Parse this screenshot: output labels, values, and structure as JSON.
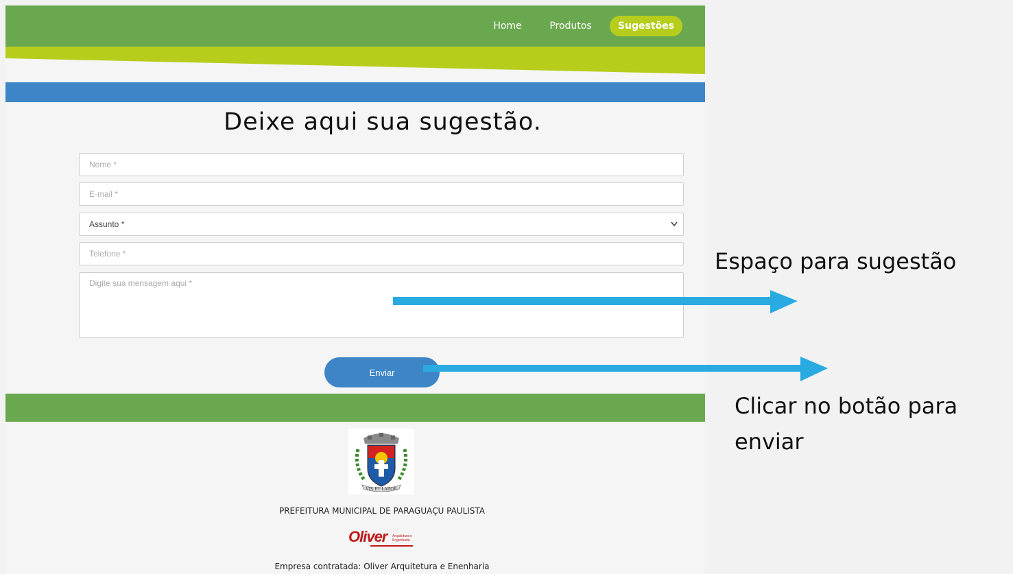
{
  "nav": {
    "items": [
      {
        "label": "Home"
      },
      {
        "label": "Produtos"
      },
      {
        "label": "Sugestões",
        "active": true
      }
    ]
  },
  "main": {
    "title": "Deixe aqui sua sugestão.",
    "form": {
      "nome_placeholder": "Nome *",
      "email_placeholder": "E-mail *",
      "assunto_selected": "Assunto *",
      "telefone_placeholder": "Telefone *",
      "mensagem_placeholder": "Digite sua mensagem aqui *",
      "submit_label": "Enviar"
    }
  },
  "footer": {
    "prefeitura": "PREFEITURA MUNICIPAL DE PARAGUAÇU PAULISTA",
    "crest_motto": "VIS ET LABOR",
    "company_logo": "Oliver",
    "company_logo_sub1": "Arquitetura e",
    "company_logo_sub2": "Engenharia",
    "empresa": "Empresa contratada: Oliver Arquitetura e Enenharia"
  },
  "annotations": {
    "message_note": "Espaço para sugestão",
    "button_note": "Clicar no botão para enviar"
  },
  "colors": {
    "header_green": "#6aa84f",
    "accent_lime": "#b6cd1b",
    "band_blue": "#3d85c6",
    "arrow_blue": "#29abe2",
    "logo_red": "#c01818"
  }
}
